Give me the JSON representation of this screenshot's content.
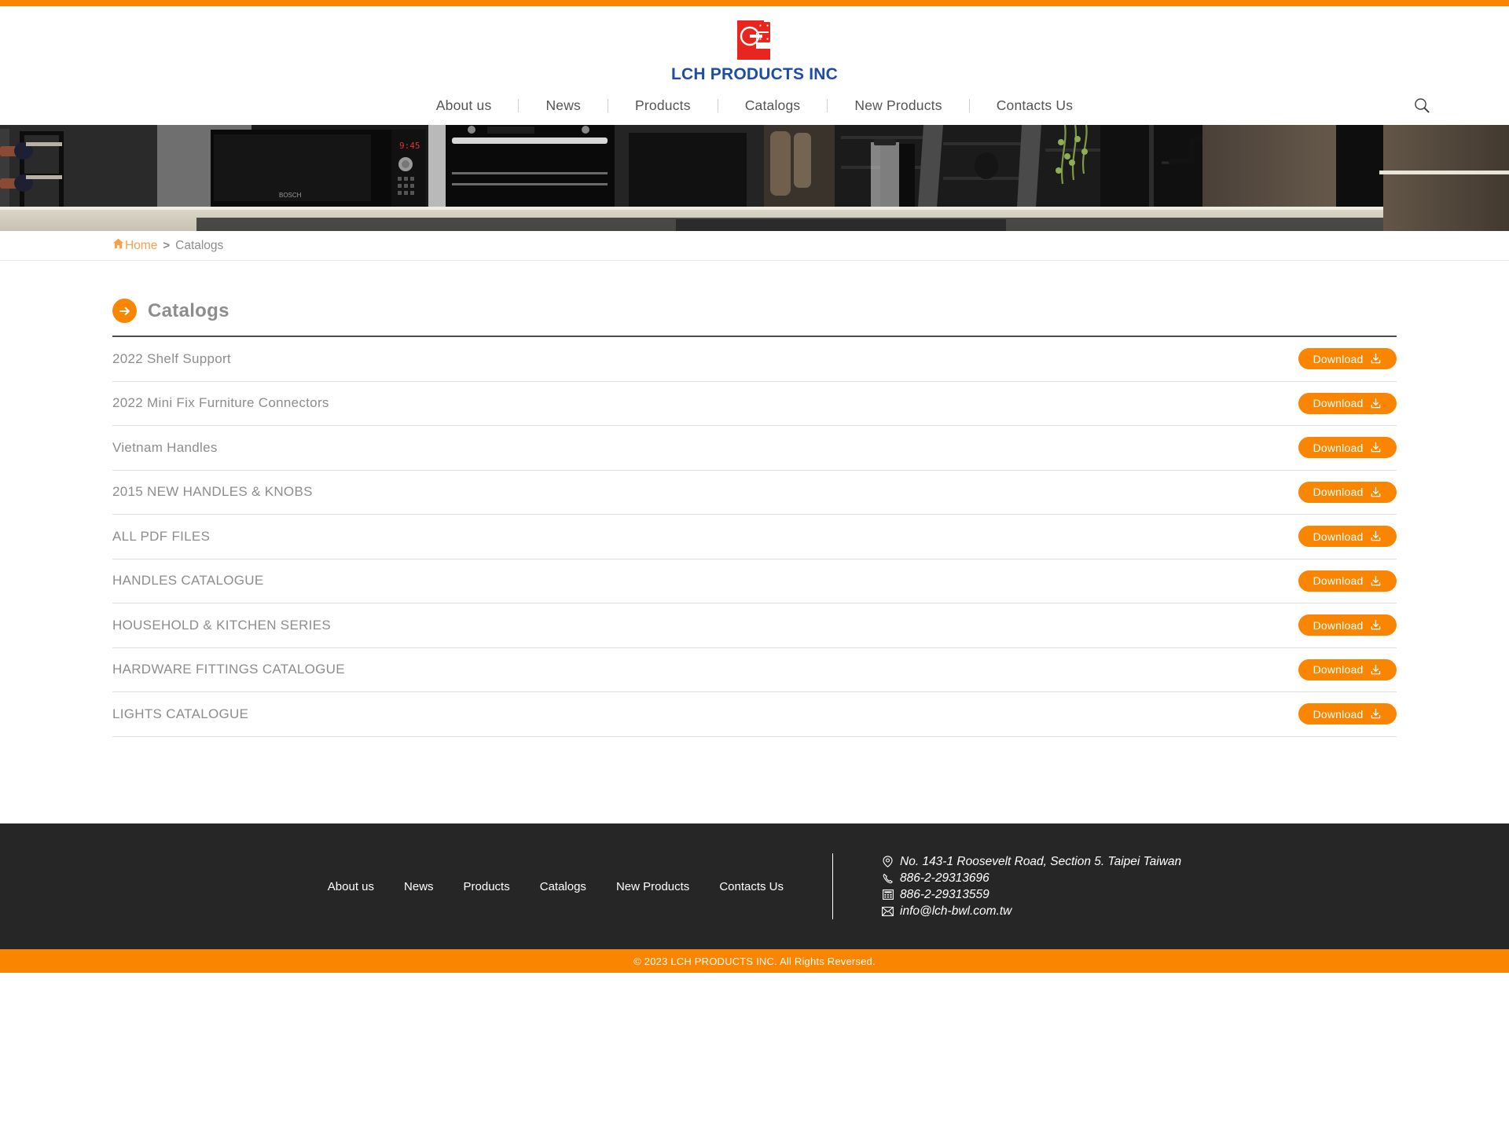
{
  "brand": {
    "name": "LCH PRODUCTS INC",
    "logo_icon": "lch-hinge-logo-icon",
    "logo_red": "#E8251F",
    "logo_blue": "#1F4EA1"
  },
  "theme": {
    "accent": "#FA8500",
    "footer_bg": "#262626",
    "text_gray": "#8d8d8d"
  },
  "nav": {
    "items": [
      {
        "label": "About us"
      },
      {
        "label": "News"
      },
      {
        "label": "Products"
      },
      {
        "label": "Catalogs"
      },
      {
        "label": "New Products"
      },
      {
        "label": "Contacts Us"
      }
    ],
    "search_icon": "search-icon"
  },
  "hero": {
    "alt": "modern dark kitchen with wine rack, built-in ovens and island countertop"
  },
  "breadcrumb": {
    "home_icon": "home-icon",
    "home": "Home",
    "separator": ">",
    "current": "Catalogs"
  },
  "page": {
    "title": "Catalogs",
    "title_icon": "arrow-right-circle-icon"
  },
  "catalogs": {
    "download_label": "Download",
    "download_icon": "download-icon",
    "items": [
      {
        "name": "2022 Shelf Support"
      },
      {
        "name": "2022 Mini Fix Furniture Connectors"
      },
      {
        "name": "Vietnam Handles"
      },
      {
        "name": "2015 NEW HANDLES & KNOBS"
      },
      {
        "name": "ALL PDF FILES"
      },
      {
        "name": "HANDLES CATALOGUE"
      },
      {
        "name": "HOUSEHOLD & KITCHEN SERIES"
      },
      {
        "name": "HARDWARE FITTINGS CATALOGUE"
      },
      {
        "name": "LIGHTS CATALOGUE"
      }
    ]
  },
  "footer": {
    "nav": [
      {
        "label": "About us"
      },
      {
        "label": "News"
      },
      {
        "label": "Products"
      },
      {
        "label": "Catalogs"
      },
      {
        "label": "New Products"
      },
      {
        "label": "Contacts Us"
      }
    ],
    "contact": {
      "address": "No. 143-1 Roosevelt Road, Section 5. Taipei Taiwan",
      "address_icon": "map-pin-icon",
      "phone": "886-2-29313696",
      "phone_icon": "phone-icon",
      "fax": "886-2-29313559",
      "fax_icon": "fax-icon",
      "email": "info@lch-bwl.com.tw",
      "email_icon": "envelope-icon"
    },
    "copyright": "© 2023 LCH PRODUCTS INC. All Rights Reversed."
  }
}
